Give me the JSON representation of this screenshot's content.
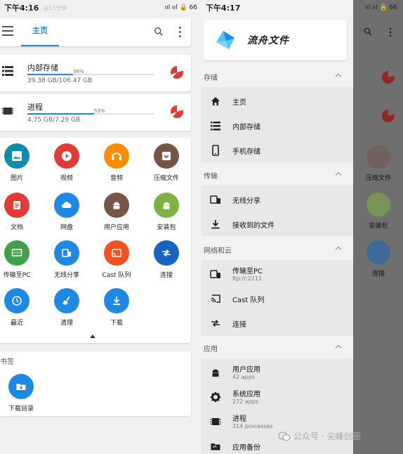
{
  "left": {
    "statusbar": {
      "time": "下午4:16",
      "note": "@15分钟",
      "icons": "ııl ııl 🔒 66"
    },
    "appbar": {
      "tab_home": "主页"
    },
    "storage": [
      {
        "title": "内部存储",
        "percent_text": "36%",
        "percent": 36,
        "size": "39.38 GB/106.47 GB"
      },
      {
        "title": "进程",
        "percent_text": "53%",
        "percent": 53,
        "size": "4.75 GB/7.29 GB"
      }
    ],
    "grid": [
      {
        "label": "图片",
        "icon": "image-icon",
        "color": "#0f8bac"
      },
      {
        "label": "视频",
        "icon": "play-icon",
        "color": "#e53935"
      },
      {
        "label": "音频",
        "icon": "headphones-icon",
        "color": "#fb8c00"
      },
      {
        "label": "压缩文件",
        "icon": "archive-icon",
        "color": "#795548"
      },
      {
        "label": "文档",
        "icon": "document-icon",
        "color": "#e53935"
      },
      {
        "label": "网盘",
        "icon": "cloud-icon",
        "color": "#1e88e5"
      },
      {
        "label": "用户应用",
        "icon": "android-icon",
        "color": "#795548"
      },
      {
        "label": "安装包",
        "icon": "android-icon",
        "color": "#7cb342"
      },
      {
        "label": "传输至PC",
        "icon": "ftp-icon",
        "color": "#43a047"
      },
      {
        "label": "无线分享",
        "icon": "devices-icon",
        "color": "#1e88e5"
      },
      {
        "label": "Cast 队列",
        "icon": "cast-icon",
        "color": "#f4511e"
      },
      {
        "label": "连接",
        "icon": "connect-icon",
        "color": "#1565c0"
      },
      {
        "label": "最近",
        "icon": "clock-icon",
        "color": "#1e88e5"
      },
      {
        "label": "清理",
        "icon": "broom-icon",
        "color": "#1e88e5"
      },
      {
        "label": "下载",
        "icon": "download-icon",
        "color": "#1e88e5"
      }
    ],
    "bookmarks": {
      "section": "书签",
      "item": {
        "label": "下载目录",
        "icon": "download-folder-icon",
        "color": "#1e88e5"
      }
    }
  },
  "right": {
    "statusbar": {
      "time": "下午4:17",
      "icons": "ııl ııl 🔒 66"
    },
    "app_name": "流舟文件",
    "sections": [
      {
        "title": "存储",
        "items": [
          {
            "label": "主页",
            "icon": "home-icon"
          },
          {
            "label": "内部存储",
            "icon": "storage-icon"
          },
          {
            "label": "手机存储",
            "icon": "phone-icon"
          }
        ]
      },
      {
        "title": "传输",
        "items": [
          {
            "label": "无线分享",
            "icon": "devices-icon"
          },
          {
            "label": "接收到的文件",
            "icon": "download-icon"
          }
        ]
      },
      {
        "title": "网络和云",
        "items": [
          {
            "label": "传输至PC",
            "sub": "ftp://:2211",
            "icon": "ftp-icon"
          },
          {
            "label": "Cast 队列",
            "icon": "cast-icon"
          },
          {
            "label": "连接",
            "icon": "connect-icon"
          }
        ]
      },
      {
        "title": "应用",
        "items": [
          {
            "label": "用户应用",
            "sub": "42 apps",
            "icon": "android-icon"
          },
          {
            "label": "系统应用",
            "sub": "272 apps",
            "icon": "gear-icon"
          },
          {
            "label": "进程",
            "sub": "314 processes",
            "icon": "process-icon"
          },
          {
            "label": "应用备份",
            "icon": "backup-icon"
          }
        ]
      }
    ],
    "background_labels": [
      "压缩文件",
      "安装包",
      "连接"
    ],
    "watermark": "公众号 · 尖峰创圈"
  }
}
